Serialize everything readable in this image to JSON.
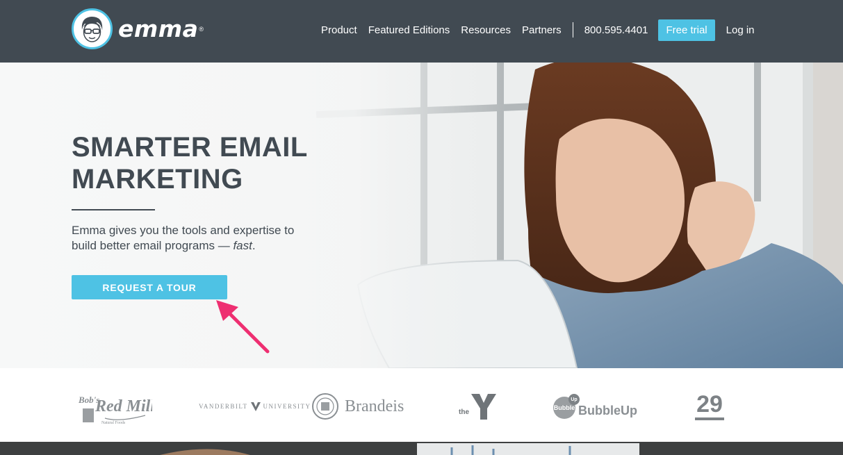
{
  "header": {
    "logo_text": "emma",
    "logo_mark": "®",
    "nav": [
      "Product",
      "Featured Editions",
      "Resources",
      "Partners"
    ],
    "phone": "800.595.4401",
    "trial_label": "Free trial",
    "login_label": "Log in"
  },
  "hero": {
    "title_line1": "SMARTER EMAIL",
    "title_line2": "MARKETING",
    "subtitle_main": "Emma gives you the tools and expertise to build better email programs — ",
    "subtitle_em": "fast",
    "subtitle_end": ".",
    "cta_label": "REQUEST A TOUR"
  },
  "clients": {
    "bobs_red_mill": "Bob's Red Mill",
    "vanderbilt_left": "VANDERBILT",
    "vanderbilt_right": "UNIVERSITY",
    "brandeis": "Brandeis",
    "ymca_the": "the",
    "bubbleup_small": "Bubble",
    "bubbleup_up": "Up",
    "bubbleup": "BubbleUp",
    "twentynine": "29"
  },
  "colors": {
    "header_bg": "#414a52",
    "accent": "#4ec2e4",
    "arrow": "#ee2f71",
    "text_dark": "#414a52"
  }
}
